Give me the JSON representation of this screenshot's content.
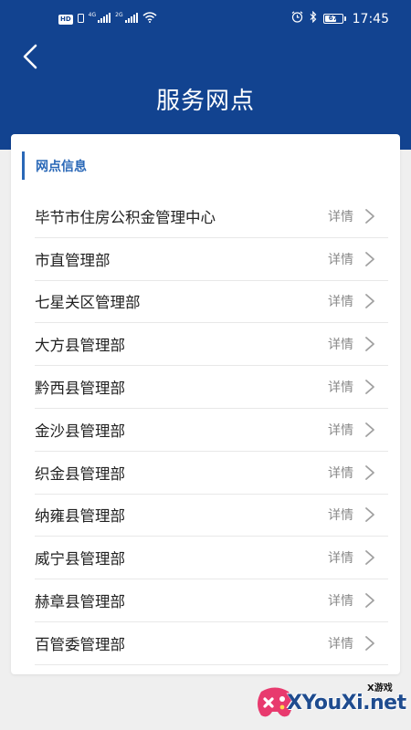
{
  "status_bar": {
    "hd": "HD",
    "net1": "4G",
    "net2": "2G",
    "battery": "67",
    "battery_level": 0.67,
    "time": "17:45"
  },
  "header": {
    "title": "服务网点",
    "background": "#124390"
  },
  "section": {
    "title": "网点信息",
    "accent": "#2a68b7"
  },
  "items": [
    {
      "name": "毕节市住房公积金管理中心",
      "detail": "详情"
    },
    {
      "name": "市直管理部",
      "detail": "详情"
    },
    {
      "name": "七星关区管理部",
      "detail": "详情"
    },
    {
      "name": "大方县管理部",
      "detail": "详情"
    },
    {
      "name": "黔西县管理部",
      "detail": "详情"
    },
    {
      "name": "金沙县管理部",
      "detail": "详情"
    },
    {
      "name": "织金县管理部",
      "detail": "详情"
    },
    {
      "name": "纳雍县管理部",
      "detail": "详情"
    },
    {
      "name": "威宁县管理部",
      "detail": "详情"
    },
    {
      "name": "赫章县管理部",
      "detail": "详情"
    },
    {
      "name": "百管委管理部",
      "detail": "详情"
    }
  ],
  "watermark": {
    "small": "X游戏",
    "main": "XYouXi.net"
  }
}
